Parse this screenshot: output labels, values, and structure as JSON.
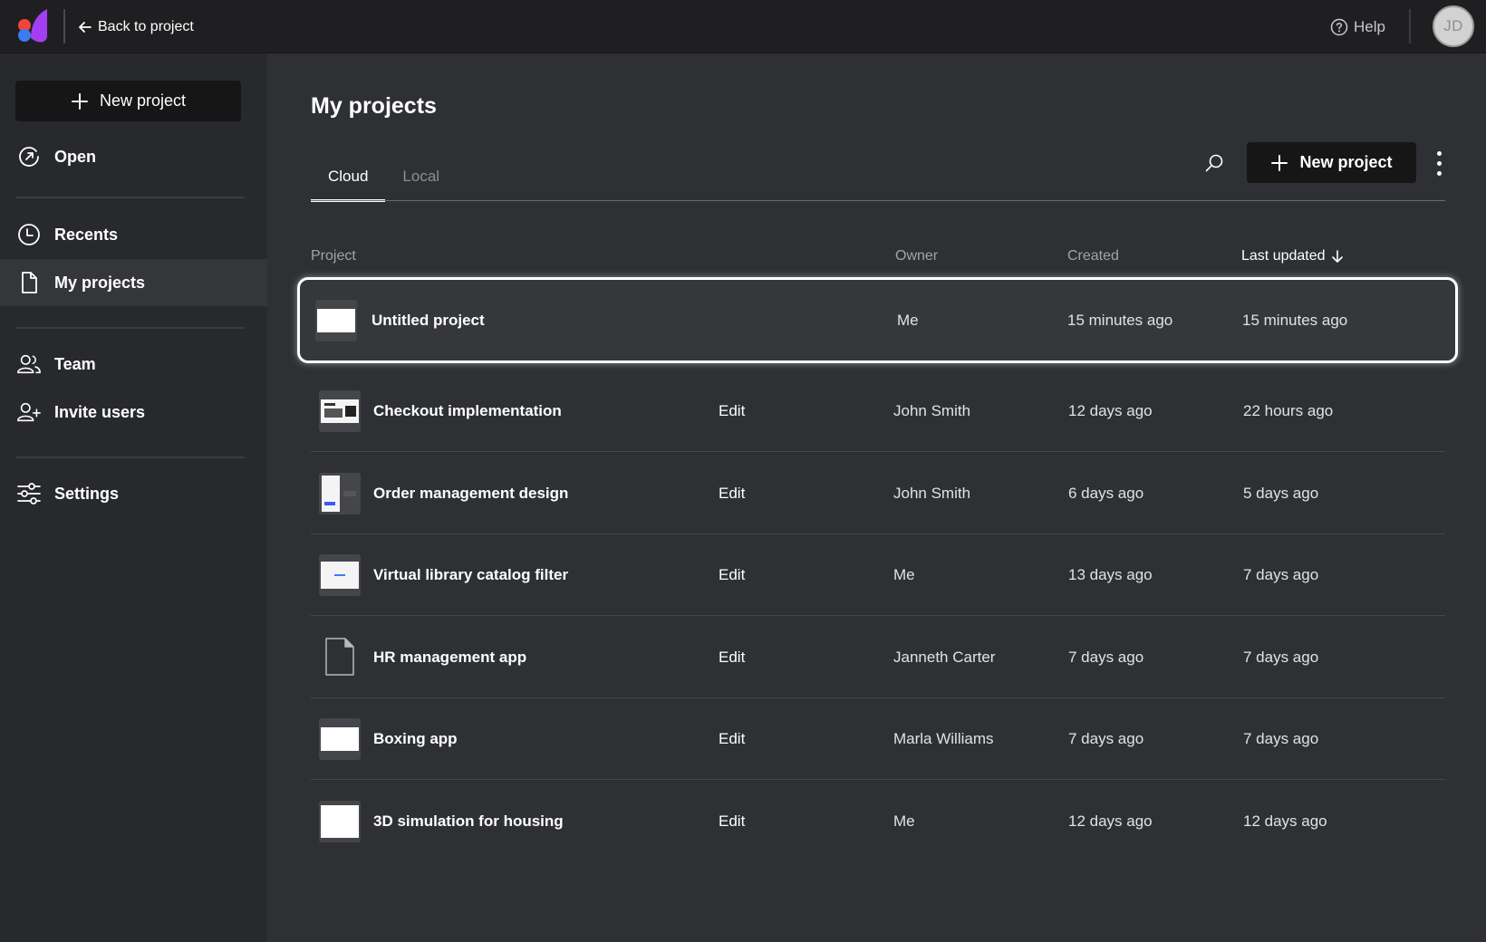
{
  "topbar": {
    "back_label": "Back to project",
    "help_label": "Help",
    "avatar_initials": "JD"
  },
  "sidebar": {
    "new_project_label": "New project",
    "items": [
      {
        "label": "Open",
        "icon": "open-icon"
      },
      {
        "label": "Recents",
        "icon": "clock-icon"
      },
      {
        "label": "My projects",
        "icon": "file-icon",
        "active": true
      },
      {
        "label": "Team",
        "icon": "team-icon"
      },
      {
        "label": "Invite users",
        "icon": "add-user-icon"
      },
      {
        "label": "Settings",
        "icon": "sliders-icon"
      }
    ]
  },
  "main": {
    "title": "My projects",
    "tabs": [
      {
        "label": "Cloud",
        "active": true
      },
      {
        "label": "Local",
        "active": false
      }
    ],
    "new_project_label": "New project",
    "columns": {
      "project": "Project",
      "owner": "Owner",
      "created": "Created",
      "last_updated": "Last updated"
    },
    "rows": [
      {
        "name": "Untitled project",
        "edit": "",
        "owner": "Me",
        "created": "15 minutes ago",
        "updated": "15 minutes ago",
        "selected": true
      },
      {
        "name": "Checkout implementation",
        "edit": "Edit",
        "owner": "John Smith",
        "created": "12 days ago",
        "updated": "22 hours ago"
      },
      {
        "name": "Order management design",
        "edit": "Edit",
        "owner": "John Smith",
        "created": "6 days ago",
        "updated": "5 days ago"
      },
      {
        "name": "Virtual library catalog filter",
        "edit": "Edit",
        "owner": "Me",
        "created": "13 days ago",
        "updated": "7 days ago"
      },
      {
        "name": "HR management app",
        "edit": "Edit",
        "owner": "Janneth Carter",
        "created": "7 days ago",
        "updated": "7 days ago"
      },
      {
        "name": "Boxing app",
        "edit": "Edit",
        "owner": "Marla Williams",
        "created": "7 days ago",
        "updated": "7 days ago"
      },
      {
        "name": "3D simulation for housing",
        "edit": "Edit",
        "owner": "Me",
        "created": "12 days ago",
        "updated": "12 days ago"
      }
    ]
  },
  "colors": {
    "topbar_bg": "#1f1f21",
    "sidebar_bg": "#28292c",
    "main_bg": "#2e3034",
    "button_bg": "#161617",
    "logo_red": "#f0443a",
    "logo_blue": "#3d7bf5",
    "logo_purple": "#a33ff0"
  }
}
